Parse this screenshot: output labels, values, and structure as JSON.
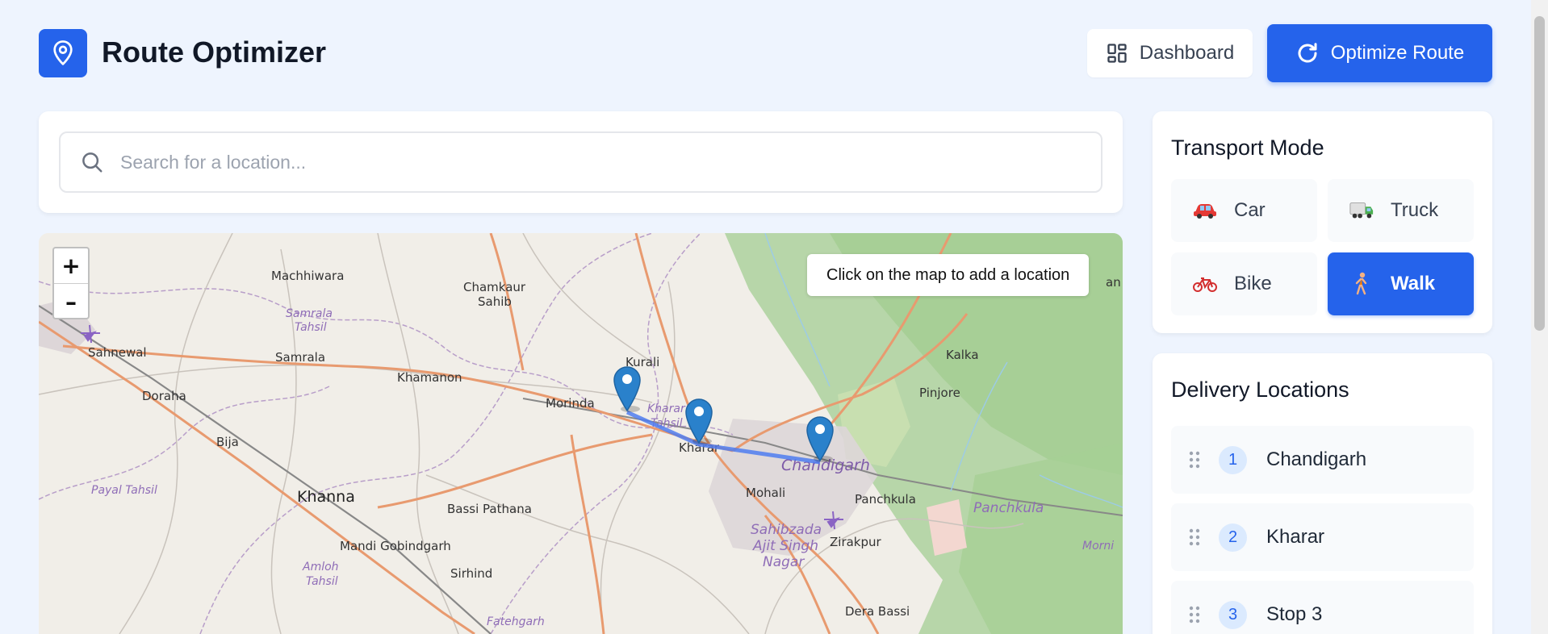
{
  "app": {
    "title": "Route Optimizer",
    "logo_icon": "map-pin-icon"
  },
  "header": {
    "dashboard_label": "Dashboard",
    "dashboard_icon": "grid-icon",
    "optimize_label": "Optimize Route",
    "optimize_icon": "refresh-icon"
  },
  "search": {
    "placeholder": "Search for a location...",
    "value": ""
  },
  "map": {
    "tip": "Click on the map to add a location",
    "zoom_in": "+",
    "zoom_out": "–",
    "places": {
      "machhiwara": "Machhiwara",
      "chamkaur": "Chamkaur",
      "sahib": "Sahib",
      "samrala_tahsil_1": "Samrala",
      "samrala_tahsil_2": "Tahsil",
      "sahnewal": "Sahnewal",
      "samrala": "Samrala",
      "khamanon": "Khamanon",
      "kurali": "Kurali",
      "kalka": "Kalka",
      "doraha": "Doraha",
      "morinda": "Morinda",
      "kharar_tahsil_1": "Kharar",
      "kharar_tahsil_2": "Tahsil",
      "pinjore": "Pinjore",
      "bija": "Bija",
      "kharar": "Kharar",
      "chandigarh": "Chandigarh",
      "payal_tahsil": "Payal Tahsil",
      "mohali": "Mohali",
      "panchkula_town": "Panchkula",
      "panchkula": "Panchkula",
      "khanna": "Khanna",
      "bassi_pathana": "Bassi Pathana",
      "sahibzada_1": "Sahibzada",
      "sahibzada_2": "Ajit Singh",
      "sahibzada_3": "Nagar",
      "zirakpur": "Zirakpur",
      "morni": "Morni",
      "mandi_gobindgarh": "Mandi Gobindgarh",
      "amloh_1": "Amloh",
      "amloh_2": "Tahsil",
      "sirhind": "Sirhind",
      "dera_bassi": "Dera Bassi",
      "fatehgarh": "Fatehgarh",
      "edge_an": "an"
    },
    "route_color": "#4f7cf0",
    "marker_color": "#2a81cb"
  },
  "transport": {
    "title": "Transport Mode",
    "modes": [
      {
        "label": "Car",
        "icon": "car-icon",
        "active": false
      },
      {
        "label": "Truck",
        "icon": "truck-icon",
        "active": false
      },
      {
        "label": "Bike",
        "icon": "bicycle-icon",
        "active": false
      },
      {
        "label": "Walk",
        "icon": "walking-person-icon",
        "active": true
      }
    ]
  },
  "deliveries": {
    "title": "Delivery Locations",
    "items": [
      {
        "num": "1",
        "name": "Chandigarh"
      },
      {
        "num": "2",
        "name": "Kharar"
      },
      {
        "num": "3",
        "name": "Stop 3"
      }
    ]
  },
  "colors": {
    "primary": "#2563eb",
    "background": "#eef4fe",
    "badge_bg": "#dbeafe"
  }
}
